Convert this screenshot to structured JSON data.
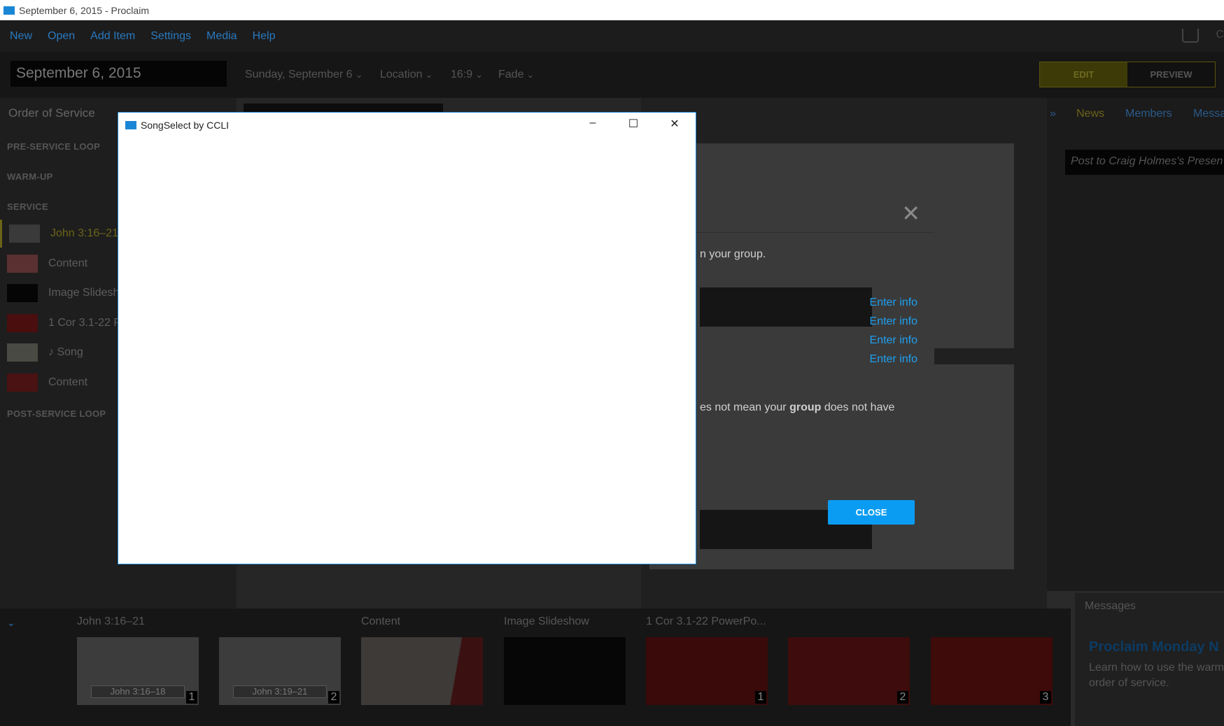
{
  "window": {
    "title": "September 6, 2015 - Proclaim"
  },
  "menu": [
    "New",
    "Open",
    "Add Item",
    "Settings",
    "Media",
    "Help"
  ],
  "menu_right": "C",
  "header": {
    "date_value": "September 6, 2015",
    "dropdowns": [
      "Sunday, September 6",
      "Location",
      "16:9",
      "Fade"
    ],
    "edit_label": "EDIT",
    "preview_label": "PREVIEW"
  },
  "sidebar": {
    "title": "Order of Service",
    "sections": [
      "PRE-SERVICE LOOP",
      "WARM-UP",
      "SERVICE",
      "POST-SERVICE LOOP"
    ],
    "items": [
      {
        "label": "John 3:16–21",
        "color": "#3a3a3a"
      },
      {
        "label": "Content",
        "color": "#5a3030"
      },
      {
        "label": "Image Slidesh",
        "color": "#050505"
      },
      {
        "label": "1 Cor 3.1-22 P",
        "color": "#4a0e0e"
      },
      {
        "label": "♪  Song",
        "color": "#4a4a44"
      },
      {
        "label": "Content",
        "color": "#4a1212"
      }
    ]
  },
  "center": {
    "tab_label": "John 3:16–21"
  },
  "right_panel": {
    "tabs": [
      "News",
      "Members",
      "Messa"
    ],
    "post_placeholder": "Post to Craig Holmes's Presen",
    "messages_title": "Messages",
    "messages_headline": "Proclaim Monday N",
    "messages_body": "Learn how to use the warm order of service."
  },
  "timeline": {
    "groups": [
      "John 3:16–21",
      "Content",
      "Image Slideshow",
      "1 Cor 3.1-22 PowerPo..."
    ],
    "captions": [
      "John 3:16–18",
      "John 3:19–21"
    ],
    "numbers": [
      "1",
      "2",
      "1",
      "2",
      "3"
    ]
  },
  "ccli_dialog": {
    "line1": "n your group.",
    "links": [
      "Enter info",
      "Enter info",
      "Enter info",
      "Enter info"
    ],
    "line2a": "es not mean your ",
    "line2b": "group",
    "line2c": " does not have",
    "close_label": "CLOSE"
  },
  "songselect": {
    "title": "SongSelect by CCLI",
    "min": "–",
    "max": "☐",
    "close": "✕"
  },
  "colors": {
    "accent": "#1a86d6",
    "link": "#1ea0f0",
    "close_button": "#0a9cf2"
  }
}
